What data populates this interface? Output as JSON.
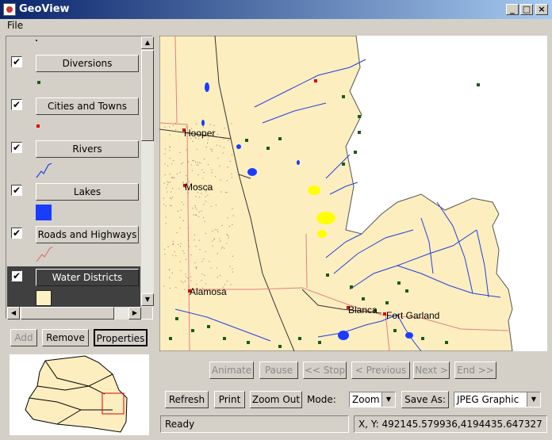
{
  "window": {
    "title": "GeoView",
    "controls": [
      "_",
      "□",
      "×"
    ]
  },
  "menu": {
    "file": "File"
  },
  "layers": [
    {
      "label": "Diversions",
      "checked": "✔",
      "legend": "small-dot",
      "color": "#1a5c1a"
    },
    {
      "label": "Cities and Towns",
      "checked": "✔",
      "legend": "small-dot",
      "color": "#e00000"
    },
    {
      "label": "Rivers",
      "checked": "✔",
      "legend": "river-line",
      "color": "#2040e0"
    },
    {
      "label": "Lakes",
      "checked": "✔",
      "legend": "square",
      "color": "#1a3cff"
    },
    {
      "label": "Roads and Highways",
      "checked": "✔",
      "legend": "road-line",
      "color": "#e06060"
    },
    {
      "label": "Water Districts",
      "checked": "✔",
      "legend": "swatch",
      "color": "#fdf1c2"
    }
  ],
  "layer_buttons": {
    "add": "Add",
    "remove": "Remove",
    "properties": "Properties"
  },
  "map": {
    "background": "#fdeec0",
    "towns": [
      "Hooper",
      "Mosca",
      "Alamosa",
      "Blanca",
      "Fort Garland"
    ]
  },
  "animation": {
    "animate": "Animate",
    "pause": "Pause",
    "stop": "<< Stop",
    "previous": "< Previous",
    "next": "Next >",
    "end": "End >>"
  },
  "toolbar": {
    "refresh": "Refresh",
    "print": "Print",
    "zoom_out": "Zoom Out",
    "mode_label": "Mode:",
    "mode_value": "Zoom",
    "save_as": "Save As:",
    "format_value": "JPEG Graphic"
  },
  "status": {
    "text": "Ready",
    "coords": "X, Y:  492145.579936,4194435.647327"
  }
}
